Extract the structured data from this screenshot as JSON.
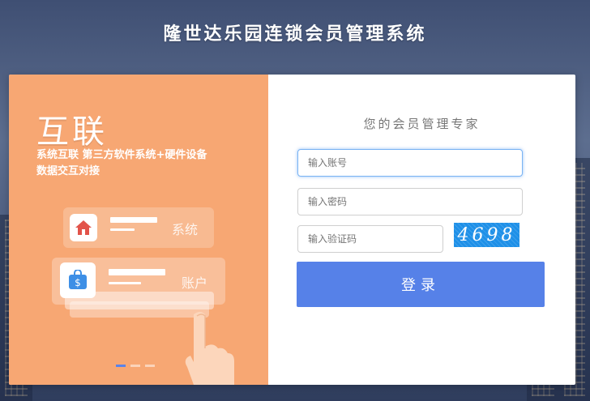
{
  "header": {
    "title": "隆世达乐园连锁会员管理系统"
  },
  "promo": {
    "heading": "互联",
    "description_line1": "系统互联  第三方软件系统+硬件设备",
    "description_line2": "数据交互对接",
    "tiles": [
      {
        "label": "系统",
        "icon": "house-icon"
      },
      {
        "label": "账户",
        "icon": "wallet-icon"
      }
    ]
  },
  "login_form": {
    "slogan": "您的会员管理专家",
    "account_placeholder": "输入账号",
    "password_placeholder": "输入密码",
    "captcha_placeholder": "输入验证码",
    "captcha_text": "4698",
    "submit_label": "登录"
  },
  "colors": {
    "accent": "#5681e8",
    "promo_bg": "#f7a773",
    "captcha_bg": "#1e90e8"
  }
}
